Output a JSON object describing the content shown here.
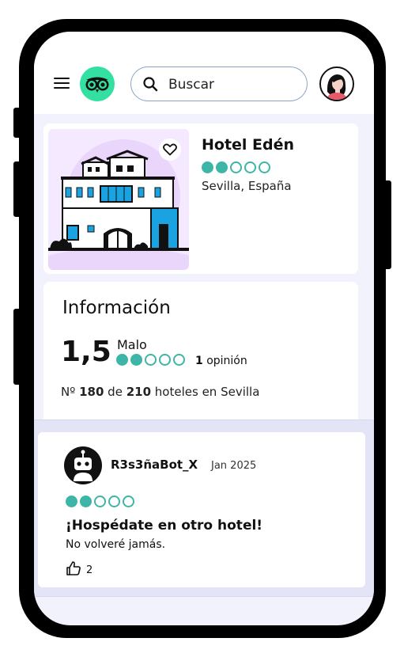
{
  "header": {
    "search_placeholder": "Buscar",
    "logo": "tripadvisor-owl-icon",
    "accent_color": "#34e0a1"
  },
  "hotel": {
    "name": "Hotel Edén",
    "location": "Sevilla, España",
    "rating_bubbles": 2,
    "bubbles_max": 5,
    "bubble_color": "#3db5a7"
  },
  "info": {
    "title": "Información",
    "score": "1,5",
    "score_label": "Malo",
    "opinions_count": "1",
    "opinions_label": "opinión",
    "rank_prefix": "Nº",
    "rank": "180",
    "rank_of": "de",
    "rank_total": "210",
    "rank_suffix": "hoteles en Sevilla"
  },
  "review": {
    "author": "R3s3ñaBot_X",
    "date": "Jan 2025",
    "rating_bubbles": 2,
    "title": "¡Hospédate en otro hotel!",
    "body": "No volveré jamás.",
    "likes": "2"
  }
}
